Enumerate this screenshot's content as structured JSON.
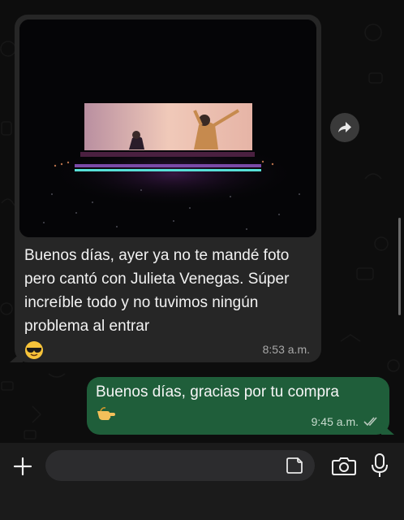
{
  "conversation": {
    "incoming": {
      "image_alt": "concert-photo",
      "text": "Buenos días, ayer ya no te mandé foto pero cantó con Julieta Venegas. Súper increíble todo y no tuvimos ningún problema al entrar",
      "emoji": "sunglasses-face-emoji",
      "time": "8:53 a.m."
    },
    "outgoing": {
      "text": "Buenos días, gracias por tu compra",
      "emoji": "pointing-hand-emoji",
      "time": "9:45 a.m.",
      "status": "read-double-check-icon"
    }
  },
  "composer": {
    "placeholder": "",
    "value": ""
  },
  "colors": {
    "incoming_bubble": "#262626",
    "outgoing_bubble": "#1f5e3a",
    "background": "#0d0d0d",
    "read_ticks": "#9fb8a8"
  }
}
